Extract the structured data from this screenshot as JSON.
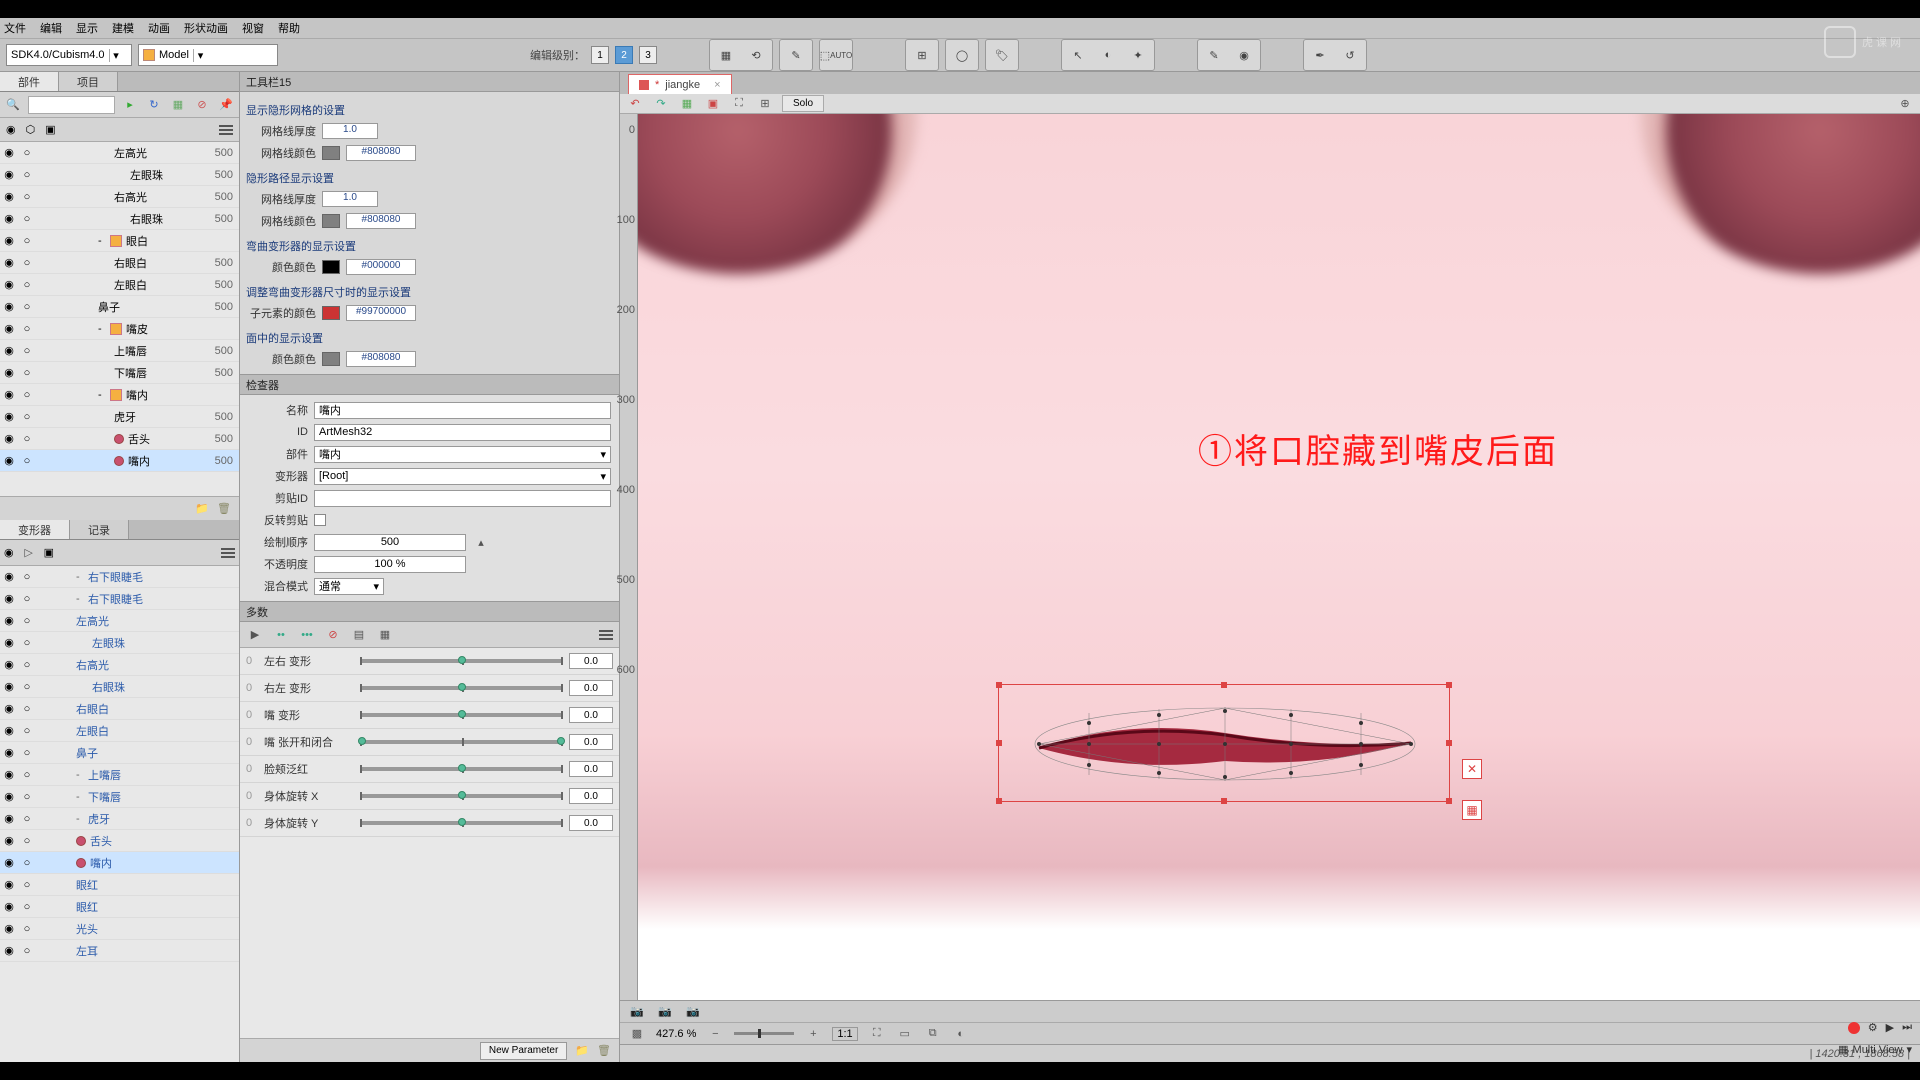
{
  "menu": {
    "file": "文件",
    "edit": "编辑",
    "view": "显示",
    "model": "建模",
    "anim": "动画",
    "formanim": "形状动画",
    "window": "视窗",
    "help": "帮助"
  },
  "toolbar": {
    "sdk": "SDK4.0/Cubism4.0",
    "mode": "Model",
    "edit_level_label": "编辑级别：",
    "levels": [
      "1",
      "2",
      "3"
    ],
    "active_level": "2",
    "auto": "AUTO"
  },
  "left": {
    "tabs": {
      "parts": "部件",
      "project": "项目"
    },
    "tree": [
      {
        "ind": 3,
        "name": "左高光",
        "num": "500"
      },
      {
        "ind": 3,
        "ico": "dark",
        "name": "左眼珠",
        "num": "500"
      },
      {
        "ind": 3,
        "name": "右高光",
        "num": "500"
      },
      {
        "ind": 3,
        "ico": "dark",
        "name": "右眼珠",
        "num": "500"
      },
      {
        "ind": 2,
        "ico": "folder",
        "exp": "-",
        "name": "眼白",
        "num": ""
      },
      {
        "ind": 3,
        "name": "右眼白",
        "num": "500"
      },
      {
        "ind": 3,
        "name": "左眼白",
        "num": "500"
      },
      {
        "ind": 2,
        "name": "鼻子",
        "num": "500"
      },
      {
        "ind": 2,
        "ico": "folder",
        "exp": "-",
        "name": "嘴皮",
        "num": ""
      },
      {
        "ind": 3,
        "name": "上嘴唇",
        "num": "500"
      },
      {
        "ind": 3,
        "name": "下嘴唇",
        "num": "500"
      },
      {
        "ind": 2,
        "ico": "folder",
        "exp": "-",
        "name": "嘴内",
        "num": ""
      },
      {
        "ind": 3,
        "name": "虎牙",
        "num": "500"
      },
      {
        "ind": 3,
        "ico": "dot",
        "name": "舌头",
        "num": "500"
      },
      {
        "ind": 3,
        "ico": "dot",
        "name": "嘴内",
        "num": "500",
        "sel": true
      }
    ],
    "def_tabs": {
      "deformer": "变形器",
      "log": "记录"
    },
    "def_tree": [
      {
        "ind": 1,
        "exp": "-",
        "name": "右下眼睫毛"
      },
      {
        "ind": 1,
        "exp": "-",
        "name": "右下眼睫毛"
      },
      {
        "ind": 1,
        "name": "左高光"
      },
      {
        "ind": 1,
        "ico": "dark",
        "name": "左眼珠"
      },
      {
        "ind": 1,
        "name": "右高光"
      },
      {
        "ind": 1,
        "ico": "dark",
        "name": "右眼珠"
      },
      {
        "ind": 1,
        "name": "右眼白"
      },
      {
        "ind": 1,
        "name": "左眼白"
      },
      {
        "ind": 1,
        "name": "鼻子"
      },
      {
        "ind": 1,
        "exp": "-",
        "name": "上嘴唇"
      },
      {
        "ind": 1,
        "exp": "-",
        "name": "下嘴唇"
      },
      {
        "ind": 1,
        "exp": "-",
        "name": "虎牙"
      },
      {
        "ind": 1,
        "ico": "dot",
        "name": "舌头"
      },
      {
        "ind": 1,
        "ico": "dot",
        "name": "嘴内",
        "sel": true
      },
      {
        "ind": 1,
        "name": "眼红"
      },
      {
        "ind": 1,
        "name": "眼红"
      },
      {
        "ind": 1,
        "name": "光头"
      },
      {
        "ind": 1,
        "name": "左耳"
      }
    ]
  },
  "center": {
    "tool_title": "工具栏15",
    "display": {
      "h1": "显示隐形网格的设置",
      "grid_depth": "网格线厚度",
      "grid_depth_v": "1.0",
      "grid_color": "网格线颜色",
      "grid_color_v": "#808080",
      "h2": "隐形路径显示设置",
      "path_depth": "网格线厚度",
      "path_depth_v": "1.0",
      "path_color": "网格线颜色",
      "path_color_v": "#808080",
      "h3": "弯曲变形器的显示设置",
      "warp_color": "颜色颜色",
      "warp_color_v": "#000000",
      "h4": "调整弯曲变形器尺寸时的显示设置",
      "child_color": "子元素的颜色",
      "child_color_v": "#99700000",
      "h5": "面中的显示设置",
      "face_color": "颜色颜色",
      "face_color_v": "#808080"
    },
    "inspector": {
      "title": "检查器",
      "name_l": "名称",
      "name_v": "嘴内",
      "id_l": "ID",
      "id_v": "ArtMesh32",
      "part_l": "部件",
      "part_v": "嘴内",
      "deform_l": "变形器",
      "deform_v": "[Root]",
      "clip_l": "剪贴ID",
      "clip_v": "",
      "invert_l": "反转剪贴",
      "draw_l": "绘制顺序",
      "draw_v": "500",
      "opacity_l": "不透明度",
      "opacity_v": "100 %",
      "blend_l": "混合模式",
      "blend_v": "通常"
    },
    "params": {
      "title": "多数",
      "rows": [
        {
          "name": "左右 变形",
          "v": "0.0"
        },
        {
          "name": "右左 变形",
          "v": "0.0"
        },
        {
          "name": "嘴 变形",
          "v": "0.0"
        },
        {
          "name": "嘴 张开和闭合",
          "v": "0.0",
          "green": true
        },
        {
          "name": "脸颊泛红",
          "v": "0.0"
        },
        {
          "name": "身体旋转 X",
          "v": "0.0"
        },
        {
          "name": "身体旋转 Y",
          "v": "0.0"
        }
      ],
      "new": "New Parameter"
    }
  },
  "doc": {
    "tab": "jiangke",
    "solo": "Solo",
    "annotation": "①将口腔藏到嘴皮后面",
    "zoom": "427.6 %",
    "ratio": "1:1",
    "multiview": "Multi View",
    "status": "| 1420.31 , 1868.58 |"
  },
  "watermark": "虎课网"
}
